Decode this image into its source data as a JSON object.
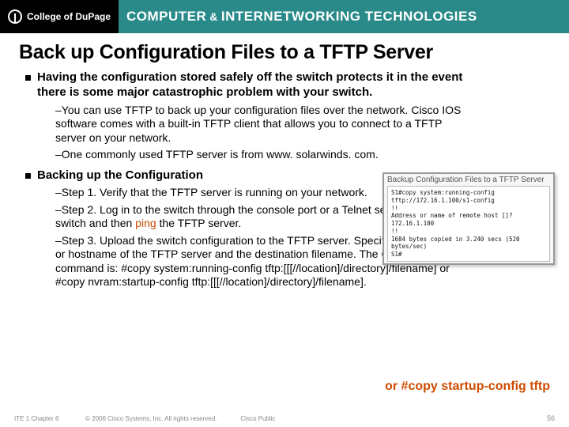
{
  "header": {
    "college_label": "College of DuPage",
    "dept_label_a": "COMPUTER",
    "dept_amp": "&",
    "dept_label_b": "INTERNETWORKING TECHNOLOGIES"
  },
  "title": "Back up Configuration Files to a TFTP Server",
  "b1": {
    "text": "Having the configuration stored safely off the switch protects it in the event there is some major catastrophic problem with your switch.",
    "s1": "–You can use TFTP to back up your configuration files over the network. Cisco IOS software comes with a built-in TFTP client that allows you to connect to a TFTP server on your network.",
    "s2": "–One commonly used TFTP server is from www. solarwinds. com."
  },
  "b2": {
    "text": "Backing up the Configuration",
    "s1a": "–Step 1. Verify that the TFTP server is running on your network.",
    "s2a": "–Step 2. Log in to the switch through the console port or a Telnet session. Enable the switch and then ",
    "s2b": "ping",
    "s2c": " the TFTP server.",
    "s3": "–Step 3. Upload the switch configuration to the TFTP server. Specify the IP address or hostname of the TFTP server and the destination filename. The Cisco IOS command is: #copy system:running-config tftp:[[[//location]/directory]/filename] or #copy nvram:startup-config tftp:[[[//location]/directory]/filename]."
  },
  "callout": {
    "title": "Backup Configuration Files to a TFTP Server",
    "body": "S1#copy system:running-config tftp://172.16.1.100/s1-config\n!!\nAddress or name of remote host []? 172.16.1.100\n!!\n1684 bytes copied in 3.240 secs (520 bytes/sec)\nS1#"
  },
  "orange_line": "or #copy startup-config tftp",
  "footer": {
    "chapter": "ITE 1 Chapter 6",
    "copyright": "© 2006 Cisco Systems, Inc. All rights reserved.",
    "public": "Cisco Public",
    "page": "56"
  }
}
